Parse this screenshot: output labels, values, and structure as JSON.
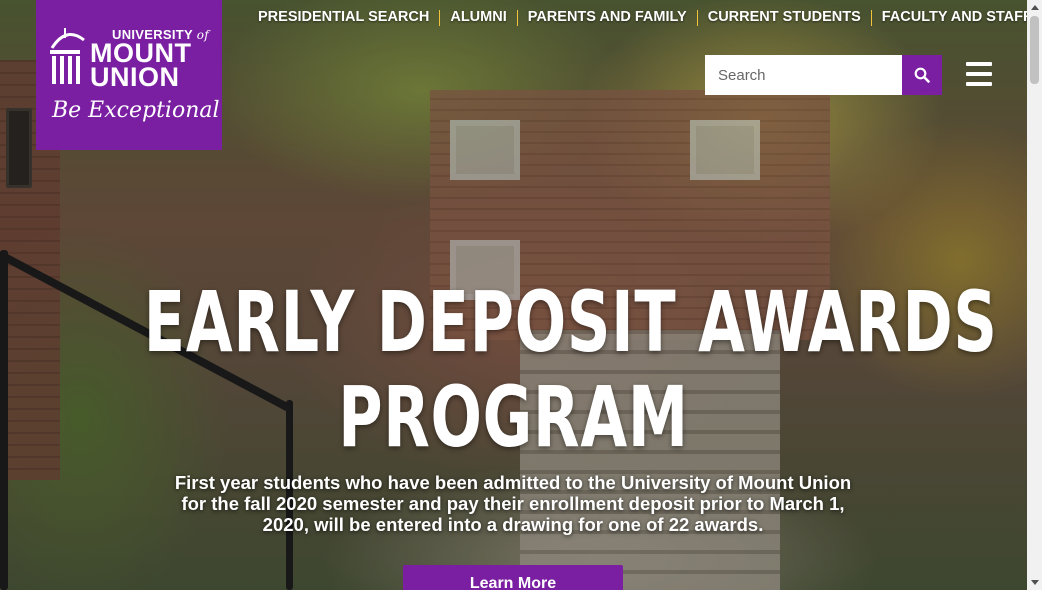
{
  "brand": {
    "line_small": "UNIVERSITY",
    "line_small_of": "of",
    "line_mount": "MOUNT",
    "line_union": "UNION",
    "tagline": "Be Exceptional",
    "color": "#7a1fa2"
  },
  "utility_nav": [
    {
      "label": "PRESIDENTIAL SEARCH"
    },
    {
      "label": "ALUMNI"
    },
    {
      "label": "PARENTS AND FAMILY"
    },
    {
      "label": "CURRENT STUDENTS"
    },
    {
      "label": "FACULTY AND STAFF"
    }
  ],
  "search": {
    "placeholder": "Search",
    "value": "",
    "icon": "search-icon"
  },
  "menu": {
    "icon": "hamburger-menu-icon"
  },
  "hero": {
    "headline_line1": "EARLY DEPOSIT AWARDS",
    "headline_line2": "PROGRAM",
    "description": "First year students who have been admitted to the University of Mount Union for the fall 2020 semester and pay their enrollment deposit prior to March 1, 2020, will be entered into a drawing for one of 22 awards.",
    "cta_label": "Learn More"
  },
  "colors": {
    "accent": "#7a1fa2",
    "separator": "#f2c33a"
  }
}
